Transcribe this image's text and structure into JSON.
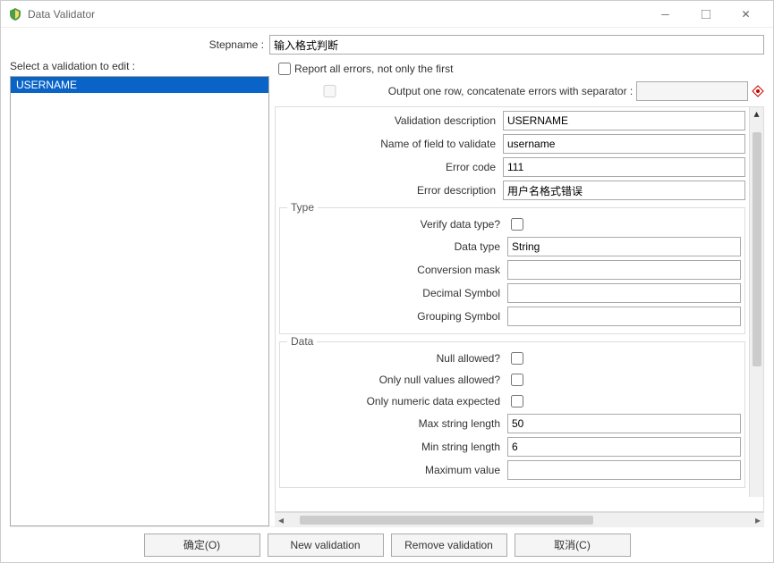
{
  "window": {
    "title": "Data Validator"
  },
  "stepname": {
    "label": "Stepname :",
    "value": "输入格式判断"
  },
  "left": {
    "label": "Select a validation to edit :",
    "items": [
      "USERNAME"
    ]
  },
  "opts": {
    "report_all": "Report all errors, not only the first",
    "output_one": "Output one row, concatenate errors with separator :",
    "separator": ""
  },
  "fields": {
    "vdesc": {
      "label": "Validation description",
      "value": "USERNAME"
    },
    "fname": {
      "label": "Name of field to validate",
      "value": "username"
    },
    "errcode": {
      "label": "Error code",
      "value": "111"
    },
    "errdesc": {
      "label": "Error description",
      "value": "用户名格式错误"
    }
  },
  "type": {
    "group": "Type",
    "verify": "Verify data type?",
    "dtype": {
      "label": "Data type",
      "value": "String"
    },
    "convmask": {
      "label": "Conversion mask",
      "value": ""
    },
    "decsym": {
      "label": "Decimal Symbol",
      "value": ""
    },
    "grpsym": {
      "label": "Grouping Symbol",
      "value": ""
    }
  },
  "data": {
    "group": "Data",
    "nullok": "Null allowed?",
    "onlynull": "Only null values allowed?",
    "onlynum": "Only numeric data expected",
    "maxlen": {
      "label": "Max string length",
      "value": "50"
    },
    "minlen": {
      "label": "Min string length",
      "value": "6"
    },
    "maxval": {
      "label": "Maximum value",
      "value": ""
    }
  },
  "buttons": {
    "ok": "确定(O)",
    "newv": "New validation",
    "remv": "Remove validation",
    "cancel": "取消(C)"
  }
}
